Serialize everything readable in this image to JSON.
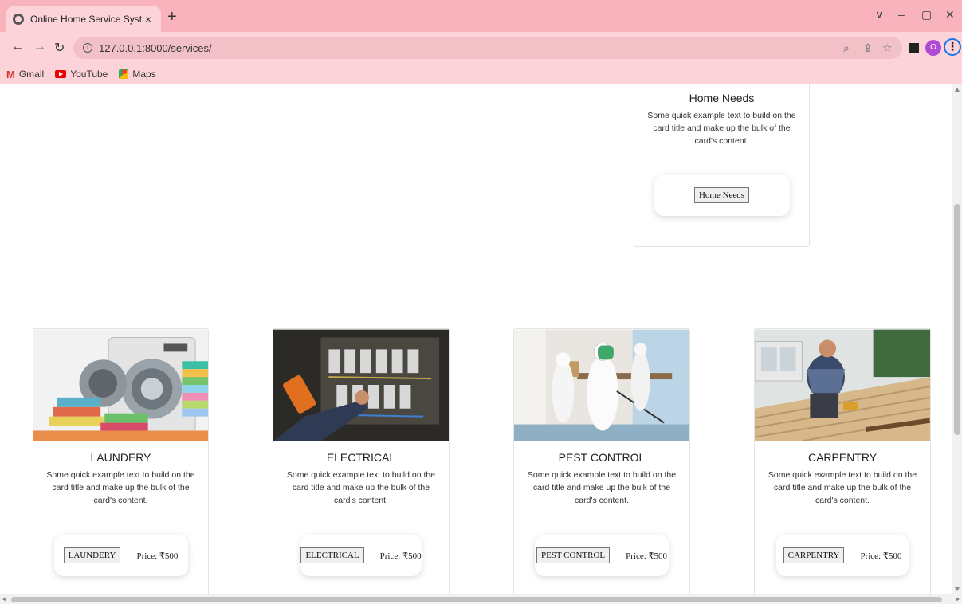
{
  "browser": {
    "tab_title": "Online Home Service System",
    "tab_close": "×",
    "new_tab": "+",
    "url": "127.0.0.1:8000/services/",
    "info_icon": "i",
    "profile_initial": "O",
    "window_controls": [
      "∨",
      "–",
      "▢",
      "✕"
    ],
    "bookmarks": [
      {
        "label": "Gmail",
        "icon": "gmail-icon"
      },
      {
        "label": "YouTube",
        "icon": "youtube-icon"
      },
      {
        "label": "Maps",
        "icon": "maps-icon"
      }
    ]
  },
  "featured_card": {
    "title": "Home Needs",
    "text": "Some quick example text to build on the card title and make up the bulk of the card's content.",
    "button_label": "Home Needs"
  },
  "services": [
    {
      "title": "LAUNDERY",
      "text": "Some quick example text to build on the card title and make up the bulk of the card's content.",
      "button_label": "LAUNDERY",
      "price": "Price: ₹500",
      "image": "laundry-machine-and-towels"
    },
    {
      "title": "ELECTRICAL",
      "text": "Some quick example text to build on the card title and make up the bulk of the card's content.",
      "button_label": "ELECTRICAL",
      "price": "Price: ₹500",
      "image": "electrician-testing-panel"
    },
    {
      "title": "PEST CONTROL",
      "text": "Some quick example text to build on the card title and make up the bulk of the card's content.",
      "button_label": "PEST CONTROL",
      "price": "Price: ₹500",
      "image": "pest-control-spraying"
    },
    {
      "title": "CARPENTRY",
      "text": "Some quick example text to build on the card title and make up the bulk of the card's content.",
      "button_label": "CARPENTRY",
      "price": "Price: ₹500",
      "image": "carpenter-drilling-deck"
    }
  ]
}
